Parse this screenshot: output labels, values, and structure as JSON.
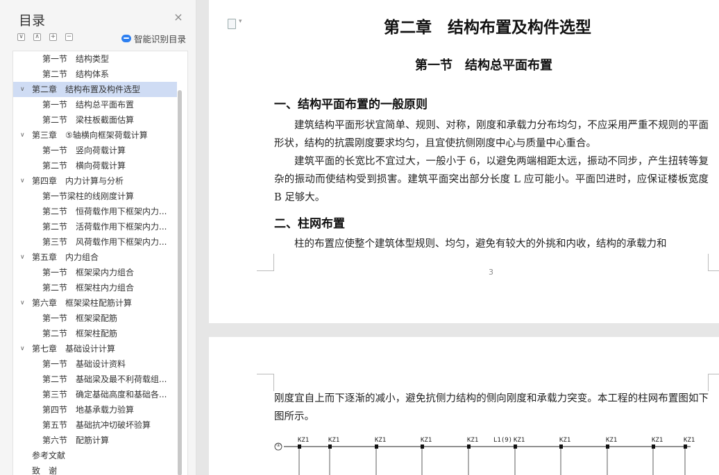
{
  "sidebar": {
    "title": "目录",
    "close_glyph": "×",
    "smart_toc_label": "智能识别目录",
    "tool_buttons": [
      "∨",
      "∧",
      "+",
      "−"
    ],
    "items": [
      {
        "label": "第一节　结构类型",
        "level": 2
      },
      {
        "label": "第二节　结构体系",
        "level": 2
      },
      {
        "label": "第二章　结构布置及构件选型",
        "level": 1,
        "expanded": true,
        "selected": true
      },
      {
        "label": "第一节　结构总平面布置",
        "level": 2
      },
      {
        "label": "第二节　梁柱板截面估算",
        "level": 2
      },
      {
        "label": "第三章　⑤轴横向框架荷载计算",
        "level": 1,
        "expanded": true
      },
      {
        "label": "第一节　竖向荷载计算",
        "level": 2
      },
      {
        "label": "第二节　横向荷载计算",
        "level": 2
      },
      {
        "label": "第四章　内力计算与分析",
        "level": 1,
        "expanded": true
      },
      {
        "label": "第一节梁柱的线刚度计算",
        "level": 2
      },
      {
        "label": "第二节　恒荷载作用下框架内力...",
        "level": 2
      },
      {
        "label": "第二节　活荷载作用下框架内力...",
        "level": 2
      },
      {
        "label": "第三节　风荷载作用下框架内力...",
        "level": 2
      },
      {
        "label": "第五章　内力组合",
        "level": 1,
        "expanded": true
      },
      {
        "label": "第一节　框架梁内力组合",
        "level": 2
      },
      {
        "label": "第二节　框架柱内力组合",
        "level": 2
      },
      {
        "label": "第六章　框架梁柱配筋计算",
        "level": 1,
        "expanded": true
      },
      {
        "label": "第一节　框架梁配筋",
        "level": 2
      },
      {
        "label": "第二节　框架柱配筋",
        "level": 2
      },
      {
        "label": "第七章　基础设计计算",
        "level": 1,
        "expanded": true
      },
      {
        "label": "第一节　基础设计资料",
        "level": 2
      },
      {
        "label": "第二节　基础梁及最不利荷载组...",
        "level": 2
      },
      {
        "label": "第三节　确定基础高度和基础各...",
        "level": 2
      },
      {
        "label": "第四节　地基承载力验算",
        "level": 2
      },
      {
        "label": "第五节　基础抗冲切破坏验算",
        "level": 2
      },
      {
        "label": "第六节　配筋计算",
        "level": 2
      },
      {
        "label": "参考文献",
        "level": 1,
        "expanded": false
      },
      {
        "label": "致　谢",
        "level": 1,
        "expanded": false
      }
    ]
  },
  "document": {
    "chapter_title": "第二章　结构布置及构件选型",
    "section_title": "第一节　结构总平面布置",
    "heading1": "一、结构平面布置的一般原则",
    "para1": "建筑结构平面形状宜简单、规则、对称，刚度和承载力分布均匀，不应采用严重不规则的平面形状，结构的抗震刚度要求均匀，且宜使抗侧刚度中心与质量中心重合。",
    "para2": "建筑平面的长宽比不宜过大，一般小于 6，以避免两端相距太远，振动不同步，产生扭转等复杂的振动而使结构受到损害。建筑平面突出部分长度 L 应可能小。平面凹进时，应保证楼板宽度 B 足够大。",
    "heading2": "二、柱网布置",
    "para3": "柱的布置应使整个建筑体型规则、均匀，避免有较大的外挑和内收，结构的承载力和",
    "page_number": "3",
    "page2_text": "刚度宜自上而下逐渐的减小，避免抗侧力结构的侧向刚度和承载力突变。本工程的柱网布置图如下图所示。",
    "drawing": {
      "axis_label": "①",
      "column_labels": [
        "KZ1",
        "KZ1",
        "KZ1",
        "KZ1",
        "KZ1",
        "L1(9)",
        "KZ1",
        "KZ1",
        "KZ1",
        "KZ1",
        "KZ1"
      ]
    }
  }
}
